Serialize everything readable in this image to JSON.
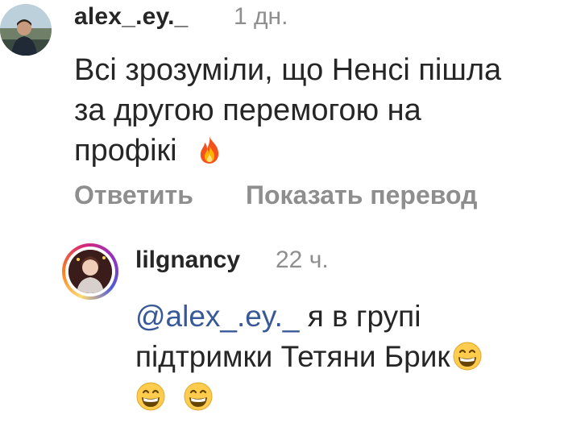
{
  "comments": [
    {
      "username": "alex_.ey._",
      "time": "1 дн.",
      "text_lines": [
        "Всі зрозуміли, що Ненсі пішла",
        "за другою перемогою на",
        "профікі"
      ],
      "trailing_emoji": "fire-icon"
    }
  ],
  "actions": {
    "reply_label": "Ответить",
    "translate_label": "Показать перевод"
  },
  "reply": {
    "username": "lilgnancy",
    "time": "22 ч.",
    "mention": "@alex_.ey._",
    "text_line1_after_mention": " я в групі",
    "text_line2": "підтримки Тетяни Брик",
    "emojis": [
      "grinning-face-icon",
      "grinning-face-icon",
      "grinning-face-icon"
    ]
  },
  "colors": {
    "text": "#262626",
    "secondary": "#8e8e8e",
    "mention": "#385898"
  }
}
